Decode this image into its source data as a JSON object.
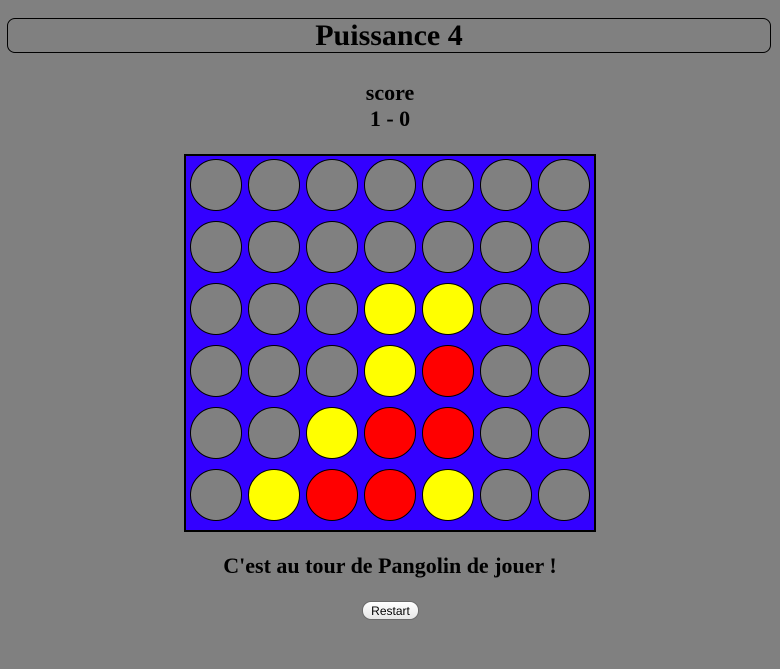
{
  "title": "Puissance 4",
  "score": {
    "label": "score",
    "value": "1 - 0"
  },
  "board": {
    "rows": 6,
    "columns": 7,
    "grid": [
      [
        "empty",
        "empty",
        "empty",
        "empty",
        "empty",
        "empty",
        "empty"
      ],
      [
        "empty",
        "empty",
        "empty",
        "empty",
        "empty",
        "empty",
        "empty"
      ],
      [
        "empty",
        "empty",
        "empty",
        "yellow",
        "yellow",
        "empty",
        "empty"
      ],
      [
        "empty",
        "empty",
        "empty",
        "yellow",
        "red",
        "empty",
        "empty"
      ],
      [
        "empty",
        "empty",
        "yellow",
        "red",
        "red",
        "empty",
        "empty"
      ],
      [
        "empty",
        "yellow",
        "red",
        "red",
        "yellow",
        "empty",
        "empty"
      ]
    ]
  },
  "colors": {
    "background": "#808080",
    "board": "#3300ff",
    "empty": "#808080",
    "red": "#ff0000",
    "yellow": "#ffff00"
  },
  "status_text": "C'est au tour de Pangolin de jouer !",
  "restart_label": "Restart"
}
